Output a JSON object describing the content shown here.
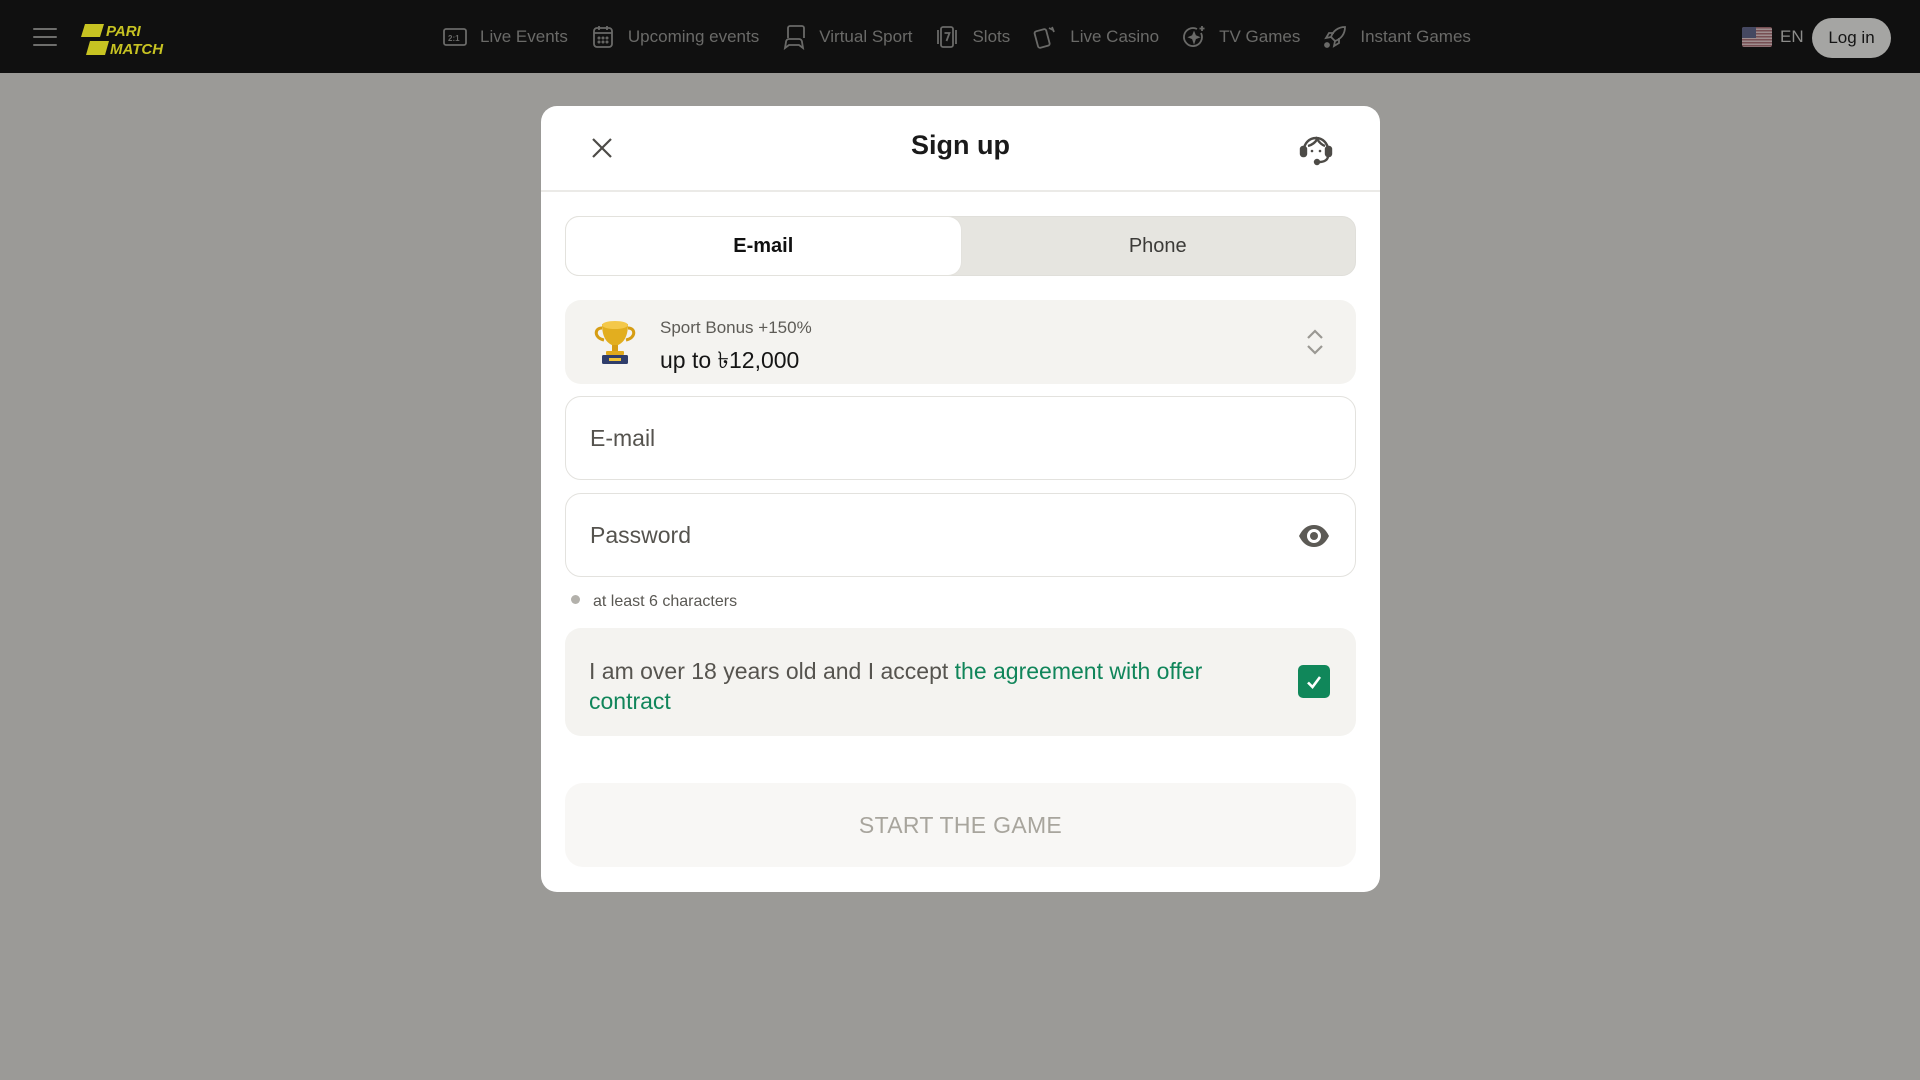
{
  "header": {
    "logo_text_top": "PARI",
    "logo_text_bottom": "MATCH",
    "brand_color": "#c7c322",
    "nav": [
      {
        "label": "Live Events",
        "icon": "scoreboard-icon"
      },
      {
        "label": "Upcoming events",
        "icon": "calendar-icon"
      },
      {
        "label": "Virtual Sport",
        "icon": "gamepad-screen-icon"
      },
      {
        "label": "Slots",
        "icon": "slot-seven-icon"
      },
      {
        "label": "Live Casino",
        "icon": "playing-cards-icon"
      },
      {
        "label": "TV Games",
        "icon": "sparkle-circle-icon"
      },
      {
        "label": "Instant Games",
        "icon": "rocket-icon"
      }
    ],
    "language": "EN",
    "login_label": "Log in"
  },
  "modal": {
    "title": "Sign up",
    "tabs": [
      {
        "label": "E-mail",
        "active": true
      },
      {
        "label": "Phone",
        "active": false
      }
    ],
    "bonus": {
      "subtitle": "Sport Bonus +150%",
      "amount": "up to ৳12,000"
    },
    "email_placeholder": "E-mail",
    "password_placeholder": "Password",
    "password_hint": "at least 6 characters",
    "agreement": {
      "text": "I am over 18 years old and I accept ",
      "link": "the agreement with offer contract",
      "checked": true,
      "accent": "#10875a"
    },
    "submit_label": "START THE GAME"
  }
}
